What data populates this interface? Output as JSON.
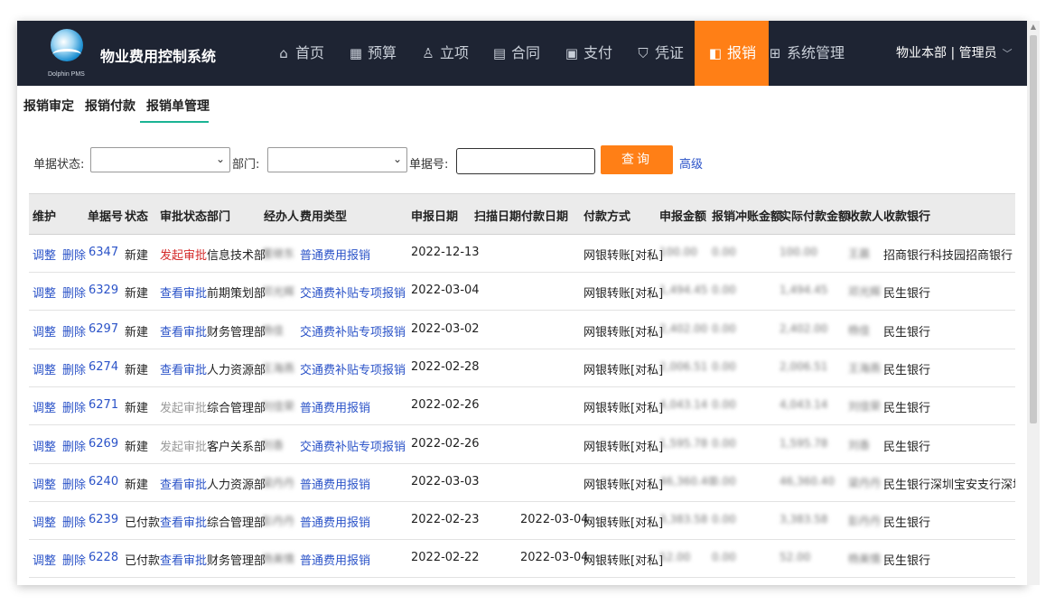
{
  "app": {
    "title": "物业费用控制系统",
    "logo_text": "Dolphin PMS",
    "user": "物业本部 | 管理员"
  },
  "nav": [
    {
      "label": "首页",
      "icon": "home-icon",
      "glyph": "⌂"
    },
    {
      "label": "预算",
      "icon": "calculator-icon",
      "glyph": "▦"
    },
    {
      "label": "立项",
      "icon": "person-icon",
      "glyph": "♙"
    },
    {
      "label": "合同",
      "icon": "document-icon",
      "glyph": "▤"
    },
    {
      "label": "支付",
      "icon": "payment-icon",
      "glyph": "▣"
    },
    {
      "label": "凭证",
      "icon": "shield-check-icon",
      "glyph": "⛉"
    },
    {
      "label": "报销",
      "icon": "wallet-icon",
      "glyph": "◧",
      "active": true
    },
    {
      "label": "系统管理",
      "icon": "grid-icon",
      "glyph": "⊞"
    }
  ],
  "subtabs": [
    "报销审定",
    "报销付款",
    "报销单管理"
  ],
  "active_subtab": "报销单管理",
  "filters": {
    "status_label": "单据状态:",
    "status_value": "",
    "dept_label": "部门:",
    "dept_value": "",
    "number_label": "单据号:",
    "number_value": "",
    "query_button": "查询",
    "advanced_link": "高级"
  },
  "table": {
    "columns": [
      "维护",
      "单据号",
      "状态",
      "审批状态",
      "部门",
      "经办人",
      "费用类型",
      "申报日期",
      "扫描日期",
      "付款日期",
      "付款方式",
      "申报金额",
      "报销冲账金额",
      "实际付款金额",
      "收款人",
      "收款银行"
    ],
    "rows": [
      {
        "edit": "调整",
        "del": "删除",
        "no": "6347",
        "status": "新建",
        "approval": "发起审批",
        "approval_style": "red",
        "dept": "信息技术部",
        "handler": "董继东",
        "type": "普通费用报销",
        "date": "2022-12-13",
        "scan": "",
        "pay": "",
        "method": "网银转账[对私]",
        "amount": "100.00",
        "offset": "0.00",
        "actual": "100.00",
        "payee": "王晨",
        "bank": "招商银行科技园招商银行"
      },
      {
        "edit": "调整",
        "del": "删除",
        "no": "6329",
        "status": "新建",
        "approval": "查看审批",
        "approval_style": "link",
        "dept": "前期策划部",
        "handler": "邓光辉",
        "type": "交通费补贴专项报销",
        "date": "2022-03-04",
        "scan": "",
        "pay": "",
        "method": "网银转账[对私]",
        "amount": "1,494.45",
        "offset": "0.00",
        "actual": "1,494.45",
        "payee": "邓光辉",
        "bank": "民生银行"
      },
      {
        "edit": "调整",
        "del": "删除",
        "no": "6297",
        "status": "新建",
        "approval": "查看审批",
        "approval_style": "link",
        "dept": "财务管理部",
        "handler": "杨佳",
        "type": "交通费补贴专项报销",
        "date": "2022-03-02",
        "scan": "",
        "pay": "",
        "method": "网银转账[对私]",
        "amount": "2,402.00",
        "offset": "0.00",
        "actual": "2,402.00",
        "payee": "杨佳",
        "bank": "民生银行"
      },
      {
        "edit": "调整",
        "del": "删除",
        "no": "6274",
        "status": "新建",
        "approval": "查看审批",
        "approval_style": "link",
        "dept": "人力资源部",
        "handler": "王海燕",
        "type": "交通费补贴专项报销",
        "date": "2022-02-28",
        "scan": "",
        "pay": "",
        "method": "网银转账[对私]",
        "amount": "2,006.51",
        "offset": "0.00",
        "actual": "2,006.51",
        "payee": "王海燕",
        "bank": "民生银行"
      },
      {
        "edit": "调整",
        "del": "删除",
        "no": "6271",
        "status": "新建",
        "approval": "发起审批",
        "approval_style": "gray",
        "dept": "综合管理部",
        "handler": "刘佳荣",
        "type": "普通费用报销",
        "date": "2022-02-26",
        "scan": "",
        "pay": "",
        "method": "网银转账[对私]",
        "amount": "4,043.14",
        "offset": "0.00",
        "actual": "4,043.14",
        "payee": "刘佳荣",
        "bank": "民生银行"
      },
      {
        "edit": "调整",
        "del": "删除",
        "no": "6269",
        "status": "新建",
        "approval": "发起审批",
        "approval_style": "gray",
        "dept": "客户关系部",
        "handler": "刘香",
        "type": "交通费补贴专项报销",
        "date": "2022-02-26",
        "scan": "",
        "pay": "",
        "method": "网银转账[对私]",
        "amount": "1,595.78",
        "offset": "0.00",
        "actual": "1,595.78",
        "payee": "刘香",
        "bank": "民生银行"
      },
      {
        "edit": "调整",
        "del": "删除",
        "no": "6240",
        "status": "新建",
        "approval": "查看审批",
        "approval_style": "link",
        "dept": "人力资源部",
        "handler": "梁丹丹",
        "type": "普通费用报销",
        "date": "2022-03-03",
        "scan": "",
        "pay": "",
        "method": "网银转账[对私]",
        "amount": "46,360.40",
        "offset": "0.00",
        "actual": "46,360.40",
        "payee": "梁丹丹",
        "bank": "民生银行深圳宝安支行深圳宝安支行"
      },
      {
        "edit": "调整",
        "del": "删除",
        "no": "6239",
        "status": "已付款",
        "approval": "查看审批",
        "approval_style": "link",
        "dept": "综合管理部",
        "handler": "彭丹丹",
        "type": "普通费用报销",
        "date": "2022-02-23",
        "scan": "",
        "pay": "2022-03-04",
        "method": "网银转账[对私]",
        "amount": "3,383.58",
        "offset": "0.00",
        "actual": "3,383.58",
        "payee": "彭丹丹",
        "bank": "民生银行"
      },
      {
        "edit": "调整",
        "del": "删除",
        "no": "6228",
        "status": "已付款",
        "approval": "查看审批",
        "approval_style": "link",
        "dept": "财务管理部",
        "handler": "杨美情",
        "type": "普通费用报销",
        "date": "2022-02-22",
        "scan": "",
        "pay": "2022-03-04",
        "method": "网银转账[对私]",
        "amount": "52.00",
        "offset": "0.00",
        "actual": "52.00",
        "payee": "杨美情",
        "bank": "民生银行"
      }
    ]
  }
}
